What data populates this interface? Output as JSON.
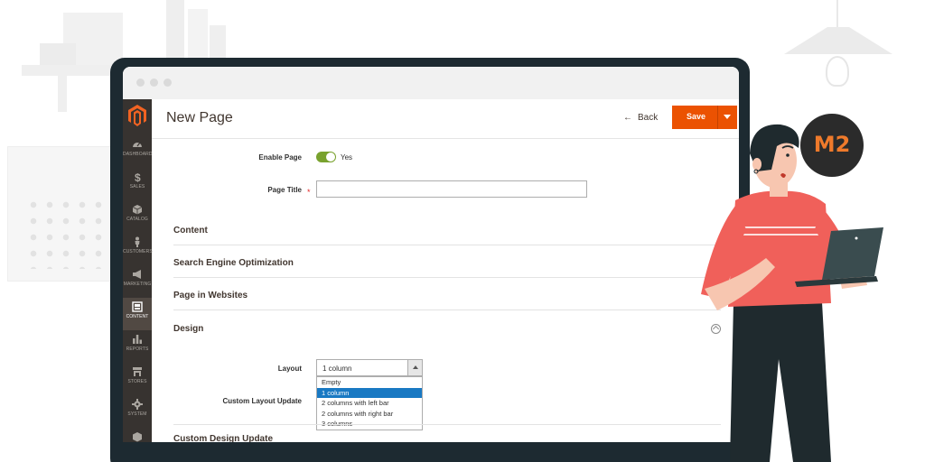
{
  "app": {
    "page_title": "New Page",
    "back_label": "Back",
    "save_label": "Save"
  },
  "sidebar": {
    "items": [
      {
        "label": "DASHBOARD",
        "icon": "dashboard-icon"
      },
      {
        "label": "SALES",
        "icon": "dollar-icon"
      },
      {
        "label": "CATALOG",
        "icon": "cube-icon"
      },
      {
        "label": "CUSTOMERS",
        "icon": "person-icon"
      },
      {
        "label": "MARKETING",
        "icon": "megaphone-icon"
      },
      {
        "label": "CONTENT",
        "icon": "content-icon",
        "active": true
      },
      {
        "label": "REPORTS",
        "icon": "bar-chart-icon"
      },
      {
        "label": "STORES",
        "icon": "store-icon"
      },
      {
        "label": "SYSTEM",
        "icon": "gear-icon"
      }
    ]
  },
  "form": {
    "enable_label": "Enable Page",
    "enable_value": "Yes",
    "title_label": "Page Title",
    "title_required": "*",
    "title_value": ""
  },
  "sections": {
    "content": "Content",
    "seo": "Search Engine Optimization",
    "websites": "Page in Websites",
    "design": "Design",
    "custom_design": "Custom Design Update"
  },
  "design": {
    "layout_label": "Layout",
    "layout_value": "1 column",
    "custom_layout_label": "Custom Layout Update",
    "options": [
      "Empty",
      "1 column",
      "2 columns with left bar",
      "2 columns with right bar",
      "3 columns"
    ],
    "selected_option": "1 column"
  },
  "badge": {
    "text": "M2"
  },
  "colors": {
    "accent": "#eb5202",
    "sidebar_bg": "#373330",
    "toggle_on": "#79a22e",
    "selection": "#1979c3",
    "shirt": "#f0605a"
  }
}
